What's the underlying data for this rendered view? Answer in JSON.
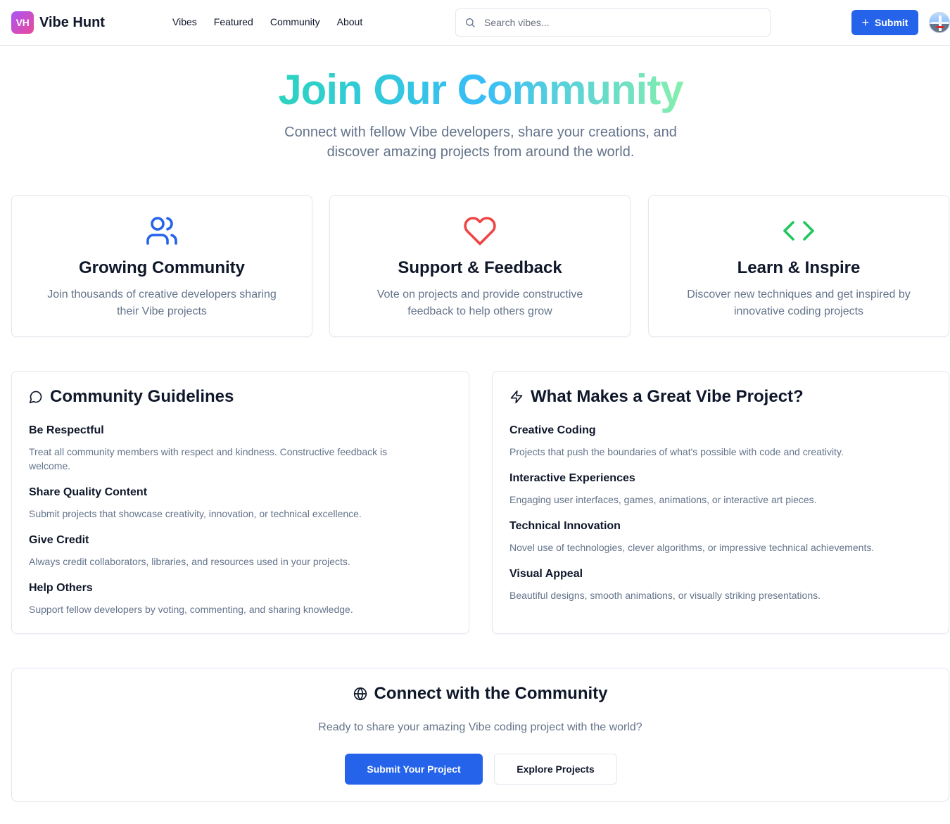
{
  "brand": {
    "badge": "VH",
    "name": "Vibe Hunt"
  },
  "nav": [
    "Vibes",
    "Featured",
    "Community",
    "About"
  ],
  "search": {
    "placeholder": "Search vibes..."
  },
  "header": {
    "submit_label": "Submit"
  },
  "hero": {
    "title": "Join Our Community",
    "subtitle": "Connect with fellow Vibe developers, share your creations, and discover amazing projects from around the world."
  },
  "features": [
    {
      "icon": "users-icon",
      "color": "#2563eb",
      "title": "Growing Community",
      "text": "Join thousands of creative developers sharing their Vibe projects"
    },
    {
      "icon": "heart-icon",
      "color": "#ef4444",
      "title": "Support & Feedback",
      "text": "Vote on projects and provide constructive feedback to help others grow"
    },
    {
      "icon": "code-icon",
      "color": "#22c55e",
      "title": "Learn & Inspire",
      "text": "Discover new techniques and get inspired by innovative coding projects"
    }
  ],
  "guidelines": {
    "title": "Community Guidelines",
    "icon": "message-circle-icon",
    "items": [
      {
        "title": "Be Respectful",
        "text": "Treat all community members with respect and kindness. Constructive feedback is welcome."
      },
      {
        "title": "Share Quality Content",
        "text": "Submit projects that showcase creativity, innovation, or technical excellence."
      },
      {
        "title": "Give Credit",
        "text": "Always credit collaborators, libraries, and resources used in your projects."
      },
      {
        "title": "Help Others",
        "text": "Support fellow developers by voting, commenting, and sharing knowledge."
      }
    ]
  },
  "great": {
    "title": "What Makes a Great Vibe Project?",
    "icon": "zap-icon",
    "items": [
      {
        "title": "Creative Coding",
        "text": "Projects that push the boundaries of what's possible with code and creativity."
      },
      {
        "title": "Interactive Experiences",
        "text": "Engaging user interfaces, games, animations, or interactive art pieces."
      },
      {
        "title": "Technical Innovation",
        "text": "Novel use of technologies, clever algorithms, or impressive technical achievements."
      },
      {
        "title": "Visual Appeal",
        "text": "Beautiful designs, smooth animations, or visually striking presentations."
      }
    ]
  },
  "cta": {
    "title": "Connect with the Community",
    "icon": "globe-icon",
    "subtitle": "Ready to share your amazing Vibe coding project with the world?",
    "primary": "Submit Your Project",
    "secondary": "Explore Projects"
  },
  "colors": {
    "accent": "#2563eb",
    "muted": "#64748b"
  }
}
